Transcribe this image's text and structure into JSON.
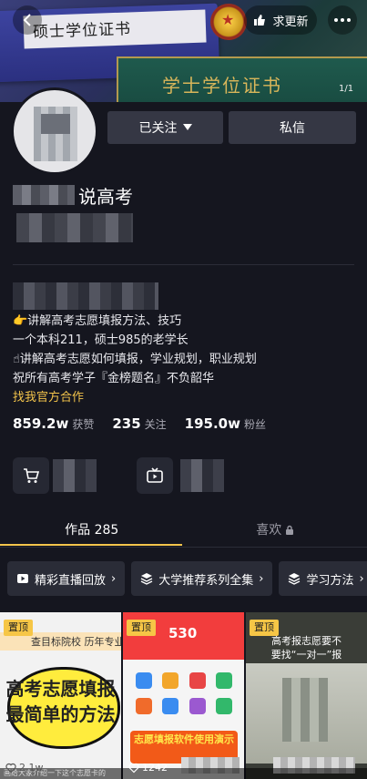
{
  "cover": {
    "cert_label_1": "硕士学位证书",
    "cert_label_2": "学士学位证书",
    "page_indicator": "1/1"
  },
  "header": {
    "request_update_label": "求更新"
  },
  "profile": {
    "follow_label": "已关注",
    "dm_label": "私信",
    "name_suffix": "说高考",
    "bio_lines": [
      "👉讲解高考志愿填报方法、技巧",
      "一个本科211，硕士985的老学长",
      "☝讲解高考志愿如何填报，学业规划，职业规划",
      "祝所有高考学子『金榜题名』不负韶华"
    ],
    "official_link": "找我官方合作",
    "stats": [
      {
        "value": "859.2w",
        "label": "获赞"
      },
      {
        "value": "235",
        "label": "关注"
      },
      {
        "value": "195.0w",
        "label": "粉丝"
      }
    ]
  },
  "tabs": {
    "works_label": "作品 285",
    "likes_label": "喜欢"
  },
  "chips": [
    {
      "label": "精彩直播回放",
      "icon": "live-replay-icon"
    },
    {
      "label": "大学推荐系列全集",
      "icon": "layers-icon"
    },
    {
      "label": "学习方法",
      "icon": "layers-icon"
    }
  ],
  "videos": [
    {
      "pinned_label": "置顶",
      "top_text": "查目标院校 历年专业录",
      "caption": "高考志愿填报最简单的方法",
      "views": "2.1w"
    },
    {
      "pinned_label": "置顶",
      "top_number": "530",
      "banner": "志愿填报软件使用演示",
      "views": "1242"
    },
    {
      "pinned_label": "置顶",
      "title": "高考报志愿要不要找“一对一”报"
    }
  ],
  "bottom_hint": "画给大家介绍一下这个志愿卡的",
  "colors": {
    "background": "#15161f",
    "button": "#353744",
    "accent_yellow": "#f3c44b",
    "pin_yellow": "#f6c646"
  }
}
